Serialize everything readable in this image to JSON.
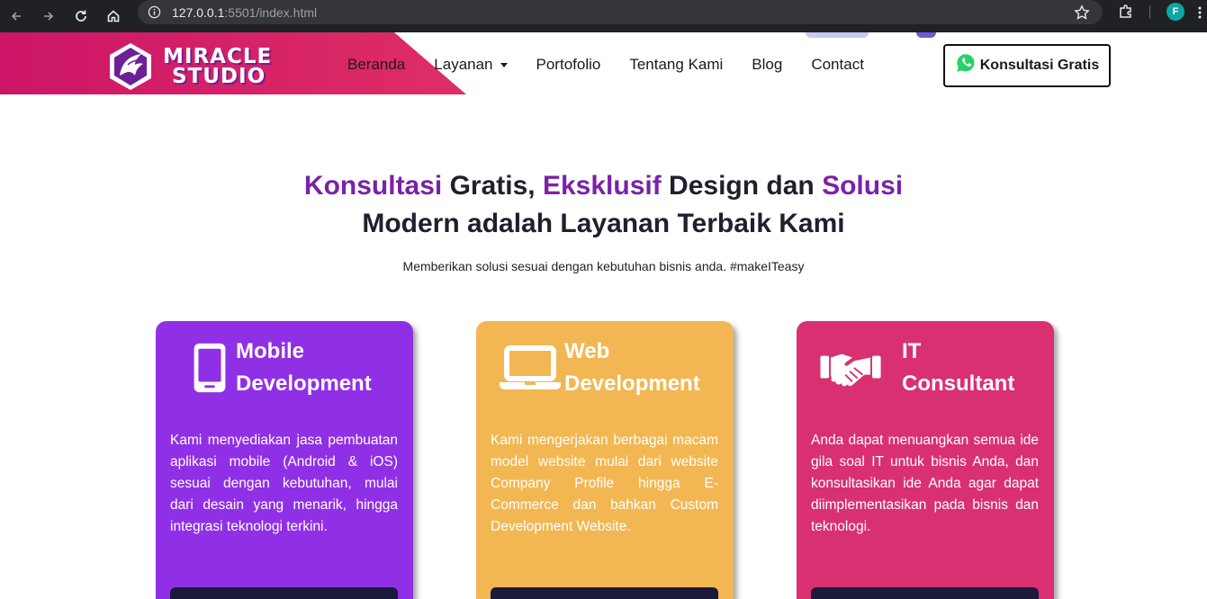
{
  "browser": {
    "url_host": "127.0.0.1",
    "url_rest": ":5501/index.html",
    "profile_initial": "F"
  },
  "header": {
    "logo_line1": "MIRACLE",
    "logo_line2": "STUDIO",
    "nav": [
      "Beranda",
      "Layanan",
      "Portofolio",
      "Tentang Kami",
      "Blog",
      "Contact"
    ],
    "cta_label": "Konsultasi Gratis"
  },
  "hero": {
    "line1": {
      "w1": "Konsultasi",
      "w2": " Gratis, ",
      "w3": "Eksklusif",
      "w4": " Design dan ",
      "w5": "Solusi"
    },
    "line2": "Modern adalah Layanan Terbaik Kami",
    "subtitle": "Memberikan solusi sesuai dengan kebutuhan bisnis anda. #makeITeasy"
  },
  "services": [
    {
      "title1": "Mobile",
      "title2": "Development",
      "icon": "smartphone-icon",
      "color": "#9030e6",
      "description": "Kami menyediakan jasa pembuatan aplikasi mobile (Android & iOS) sesuai dengan kebutuhan, mulai dari desain yang menarik, hingga integrasi teknologi terkini."
    },
    {
      "title1": "Web",
      "title2": "Development",
      "icon": "laptop-icon",
      "color": "#f2b752",
      "description": "Kami mengerjakan berbagai macam model website mulai dari website Company Profile hingga E-Commerce dan bahkan Custom Development Website."
    },
    {
      "title1": "IT",
      "title2": "Consultant",
      "icon": "handshake-icon",
      "color": "#d93072",
      "description": "Anda dapat menuangkan semua ide gila soal IT untuk bisnis Anda, dan konsultasikan ide Anda agar dapat diimplementasikan pada bisnis dan teknologi."
    }
  ]
}
